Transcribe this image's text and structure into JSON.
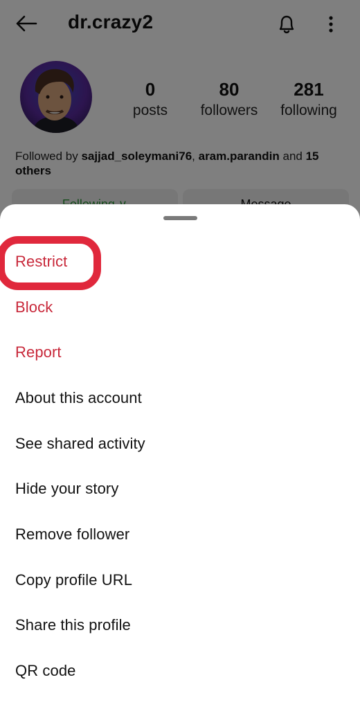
{
  "header": {
    "username": "dr.crazy2",
    "back_icon": "arrow-left-icon",
    "notifications_icon": "bell-icon",
    "more_icon": "vertical-dots-icon"
  },
  "profile": {
    "avatar_alt": "profile picture",
    "stats": [
      {
        "value": "0",
        "label": "posts"
      },
      {
        "value": "80",
        "label": "followers"
      },
      {
        "value": "281",
        "label": "following"
      }
    ],
    "followed_by": {
      "prefix": "Followed by ",
      "user1": "sajjad_soleymani76",
      "sep": ", ",
      "user2": "aram.parandin",
      "and": " and ",
      "others": "15 others"
    },
    "buttons": {
      "following_label": "Following ∨",
      "message_label": "Message"
    }
  },
  "sheet": {
    "items": [
      {
        "label": "Restrict",
        "style": "danger"
      },
      {
        "label": "Block",
        "style": "danger"
      },
      {
        "label": "Report",
        "style": "danger"
      },
      {
        "label": "About this account",
        "style": "normal"
      },
      {
        "label": "See shared activity",
        "style": "normal"
      },
      {
        "label": "Hide your story",
        "style": "normal"
      },
      {
        "label": "Remove follower",
        "style": "normal"
      },
      {
        "label": "Copy profile URL",
        "style": "normal"
      },
      {
        "label": "Share this profile",
        "style": "normal"
      },
      {
        "label": "QR code",
        "style": "normal"
      }
    ],
    "highlighted_item": "Restrict"
  },
  "colors": {
    "danger": "#c8283a",
    "highlight_ring": "#e0283c",
    "following_green": "#2e9a3a"
  }
}
